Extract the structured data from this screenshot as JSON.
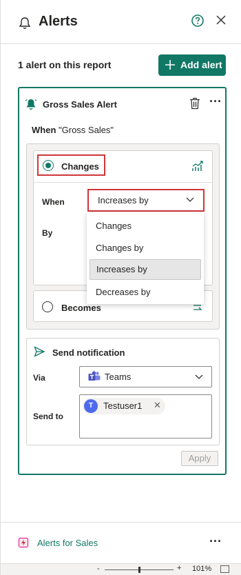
{
  "header": {
    "title": "Alerts",
    "help_icon": "question-circle-icon",
    "close_icon": "close-icon"
  },
  "summary": {
    "count_text": "1 alert on this report",
    "add_button": "Add alert"
  },
  "alert": {
    "title": "Gross Sales Alert",
    "when_label": "When",
    "when_value": "\"Gross Sales\"",
    "condition": {
      "changes_label": "Changes",
      "when_label": "When",
      "when_select": "Increases by",
      "by_label": "By",
      "becomes_label": "Becomes"
    },
    "dropdown": {
      "options": [
        "Changes",
        "Changes by",
        "Increases by",
        "Decreases by"
      ],
      "selected": "Increases by"
    },
    "notification": {
      "title": "Send notification",
      "via_label": "Via",
      "via_value": "Teams",
      "send_to_label": "Send to",
      "recipient_initial": "T",
      "recipient": "Testuser1",
      "remove": "✕"
    },
    "apply": "Apply"
  },
  "footer": {
    "link": "Alerts for Sales",
    "more": "···"
  },
  "statusbar": {
    "minus": "-",
    "plus": "+",
    "zoom": "101%"
  },
  "colors": {
    "accent": "#117865",
    "highlight": "#d13438",
    "avatar": "#4f6bed"
  }
}
